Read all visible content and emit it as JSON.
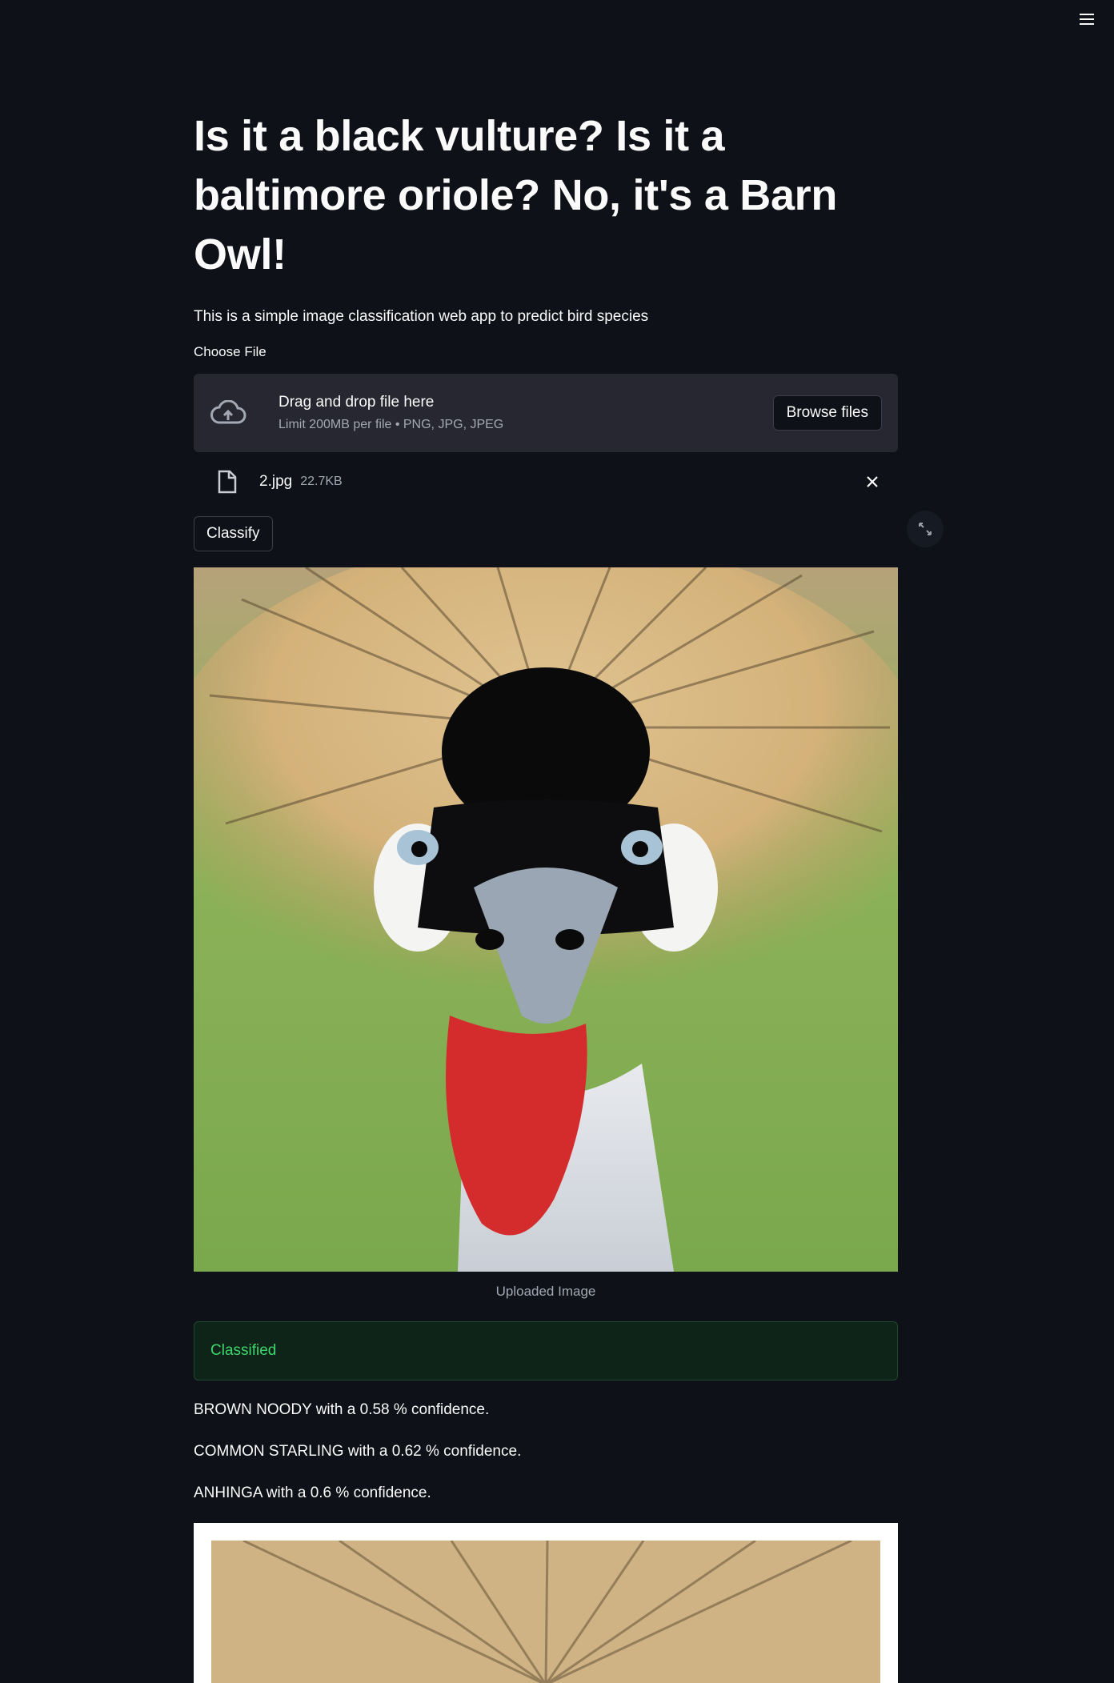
{
  "app": {
    "menu_icon": "hamburger-menu-icon"
  },
  "header": {
    "title": "Is it a black vulture? Is it a baltimore oriole? No, it's a Barn Owl!",
    "description": "This is a simple image classification web app to predict bird species"
  },
  "uploader": {
    "label": "Choose File",
    "drop_text": "Drag and drop file here",
    "limit_text": "Limit 200MB per file • PNG, JPG, JPEG",
    "browse_label": "Browse files",
    "file": {
      "name": "2.jpg",
      "size": "22.7KB"
    }
  },
  "actions": {
    "classify_label": "Classify"
  },
  "image": {
    "caption": "Uploaded Image"
  },
  "result": {
    "status": "Classified",
    "predictions": [
      "BROWN NOODY with a 0.58 % confidence.",
      "COMMON STARLING with a 0.62 % confidence.",
      "ANHINGA with a 0.6 % confidence."
    ]
  },
  "colors": {
    "background": "#0e1117",
    "panel": "#262730",
    "success_text": "#3dd56d",
    "success_bg": "#0f2419"
  }
}
